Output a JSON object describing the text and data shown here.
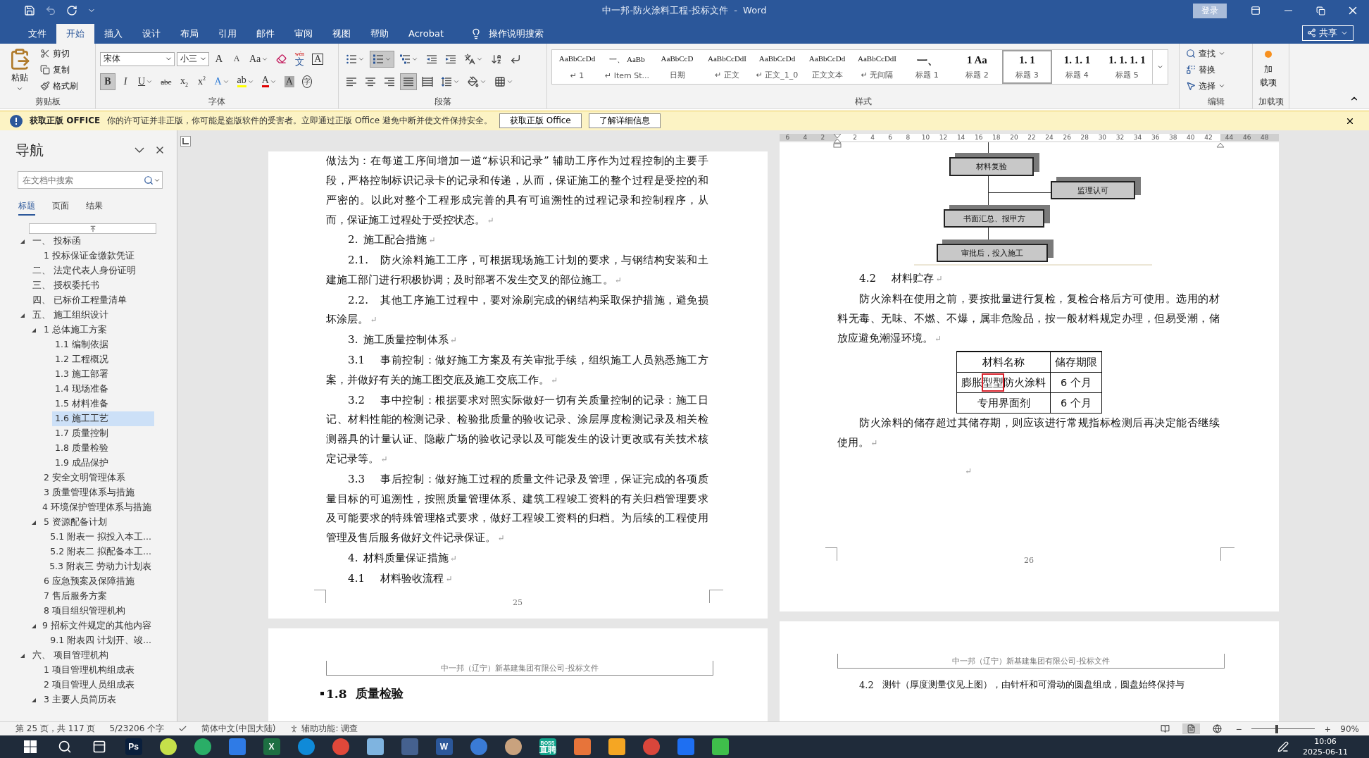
{
  "title_bar": {
    "title": "中一邦-防火涂料工程-投标文件  -  Word",
    "signin": "登录"
  },
  "ribbon_tabs": [
    {
      "label": "文件",
      "selected": false
    },
    {
      "label": "开始",
      "selected": true
    },
    {
      "label": "插入",
      "selected": false
    },
    {
      "label": "设计",
      "selected": false
    },
    {
      "label": "布局",
      "selected": false
    },
    {
      "label": "引用",
      "selected": false
    },
    {
      "label": "邮件",
      "selected": false
    },
    {
      "label": "审阅",
      "selected": false
    },
    {
      "label": "视图",
      "selected": false
    },
    {
      "label": "帮助",
      "selected": false
    },
    {
      "label": "Acrobat",
      "selected": false
    }
  ],
  "tell_me": "操作说明搜索",
  "share": "共享",
  "ribbon": {
    "clipboard": {
      "label": "剪贴板",
      "paste": "粘贴",
      "actions": [
        {
          "kind": "cut",
          "label": "剪切"
        },
        {
          "kind": "copy",
          "label": "复制"
        },
        {
          "kind": "painter",
          "label": "格式刷"
        }
      ]
    },
    "font": {
      "label": "字体",
      "font_name": "宋体",
      "font_size": "小三",
      "row1": [
        {
          "kind": "grow",
          "text": "A"
        },
        {
          "kind": "shrink",
          "text": "A"
        },
        {
          "kind": "case",
          "text": "Aa",
          "dropdown": true
        },
        {
          "kind": "clear"
        },
        {
          "kind": "phonetic",
          "text": "文",
          "ruby": "wén"
        },
        {
          "kind": "border",
          "text": "A"
        }
      ],
      "row2": [
        {
          "kind": "bold",
          "text": "B",
          "pressed": true
        },
        {
          "kind": "italic",
          "text": "I",
          "pressed": false
        },
        {
          "kind": "underline",
          "text": "U",
          "pressed": false,
          "dropdown": true
        },
        {
          "kind": "strike",
          "text": "abc"
        },
        {
          "kind": "sub",
          "text": "x",
          "script": "2"
        },
        {
          "kind": "sup",
          "text": "x",
          "script": "2"
        },
        {
          "kind": "effects",
          "text": "A",
          "dropdown": true
        },
        {
          "kind": "highlight",
          "text": "ab",
          "color": "#ffff00",
          "dropdown": true
        },
        {
          "kind": "color",
          "text": "A",
          "color": "#e00000",
          "dropdown": true
        },
        {
          "kind": "shading",
          "text": "A"
        },
        {
          "kind": "enclose",
          "text": "字"
        }
      ]
    },
    "paragraph": {
      "label": "段落",
      "row1": [
        {
          "kind": "bullets",
          "pressed": false,
          "dropdown": true
        },
        {
          "kind": "numbering",
          "pressed": true,
          "dropdown": true
        },
        {
          "kind": "multilevel",
          "pressed": false,
          "dropdown": true
        },
        {
          "kind": "outdent",
          "pressed": false
        },
        {
          "kind": "indent",
          "pressed": false
        },
        {
          "kind": "asian",
          "pressed": false,
          "dropdown": true
        },
        {
          "kind": "sort",
          "pressed": false
        },
        {
          "kind": "marks",
          "pressed": false
        }
      ],
      "row2": [
        {
          "kind": "left",
          "pressed": false
        },
        {
          "kind": "center",
          "pressed": false
        },
        {
          "kind": "right",
          "pressed": false
        },
        {
          "kind": "justify",
          "pressed": true
        },
        {
          "kind": "distributed",
          "pressed": false
        },
        {
          "kind": "spacing",
          "pressed": false,
          "dropdown": true
        },
        {
          "kind": "shading",
          "pressed": false,
          "dropdown": true
        },
        {
          "kind": "borders",
          "pressed": false,
          "dropdown": true
        }
      ]
    },
    "styles": {
      "label": "样式",
      "items": [
        {
          "kind": "normal",
          "preview": "AaBbCcDd",
          "name": "↵ 1",
          "selected": false
        },
        {
          "kind": "normal",
          "preview": "一、 AaBb",
          "name": "↵ Item St...",
          "selected": false
        },
        {
          "kind": "normal",
          "preview": "AaBbCcD",
          "name": "日期",
          "selected": false
        },
        {
          "kind": "normal",
          "preview": "AaBbCcDdI",
          "name": "↵ 正文",
          "selected": false
        },
        {
          "kind": "normal",
          "preview": "AaBbCcDd",
          "name": "↵ 正文_1_0",
          "selected": false
        },
        {
          "kind": "normal",
          "preview": "AaBbCcDd",
          "name": "正文文本",
          "selected": false
        },
        {
          "kind": "normal",
          "preview": "AaBbCcDdI",
          "name": "↵ 无间隔",
          "selected": false
        },
        {
          "kind": "heading",
          "preview": "一、",
          "name": "标题 1",
          "selected": false
        },
        {
          "kind": "heading",
          "preview": "1   Aa",
          "name": "标题 2",
          "selected": false
        },
        {
          "kind": "heading",
          "preview": "1. 1",
          "name": "标题 3",
          "selected": true
        },
        {
          "kind": "heading",
          "preview": "1. 1. 1",
          "name": "标题 4",
          "selected": false
        },
        {
          "kind": "heading",
          "preview": "1. 1. 1. 1",
          "name": "标题 5",
          "selected": false
        }
      ]
    },
    "editing": {
      "label": "编辑",
      "actions": [
        {
          "kind": "find",
          "label": "查找",
          "dropdown": true
        },
        {
          "kind": "replace",
          "label": "替换",
          "dropdown": false
        },
        {
          "kind": "select",
          "label": "选择",
          "dropdown": true
        }
      ]
    },
    "addins": {
      "label": "加载项",
      "button_lines": [
        "加",
        "载项"
      ]
    }
  },
  "message_bar": {
    "title": "获取正版 OFFICE",
    "text": "你的许可证并非正版，你可能是盗版软件的受害者。立即通过正版 Office 避免中断并使文件保持安全。",
    "buttons": [
      "获取正版 Office",
      "了解详细信息"
    ]
  },
  "navigation": {
    "title": "导航",
    "search_placeholder": "在文档中搜索",
    "tabs": [
      {
        "label": "标题",
        "selected": true
      },
      {
        "label": "页面",
        "selected": false
      },
      {
        "label": "结果",
        "selected": false
      }
    ],
    "tree": [
      {
        "label": "一、 投标函",
        "expanded": true,
        "selected": false,
        "children": [
          {
            "label": "1 投标保证金缴款凭证",
            "selected": false
          }
        ]
      },
      {
        "label": "二、 法定代表人身份证明",
        "selected": false
      },
      {
        "label": "三、 授权委托书",
        "selected": false
      },
      {
        "label": "四、 已标价工程量清单",
        "selected": false
      },
      {
        "label": "五、 施工组织设计",
        "expanded": true,
        "selected": false,
        "children": [
          {
            "label": "1 总体施工方案",
            "expanded": true,
            "selected": false,
            "children": [
              {
                "label": "1.1 编制依据",
                "selected": false
              },
              {
                "label": "1.2 工程概况",
                "selected": false
              },
              {
                "label": "1.3 施工部署",
                "selected": false
              },
              {
                "label": "1.4 现场准备",
                "selected": false
              },
              {
                "label": "1.5 材料准备",
                "selected": false
              },
              {
                "label": "1.6 施工工艺",
                "selected": true
              },
              {
                "label": "1.7 质量控制",
                "selected": false
              },
              {
                "label": "1.8 质量检验",
                "selected": false
              },
              {
                "label": "1.9 成品保护",
                "selected": false
              }
            ]
          },
          {
            "label": "2 安全文明管理体系",
            "selected": false
          },
          {
            "label": "3 质量管理体系与措施",
            "selected": false
          },
          {
            "label": "4 环境保护管理体系与措施",
            "selected": false
          },
          {
            "label": "5 资源配备计划",
            "expanded": true,
            "selected": false,
            "children": [
              {
                "label": "5.1 附表一  拟投入本工...",
                "selected": false
              },
              {
                "label": "5.2 附表二  拟配备本工...",
                "selected": false
              },
              {
                "label": "5.3 附表三  劳动力计划表",
                "selected": false
              }
            ]
          },
          {
            "label": "6 应急预案及保障措施",
            "selected": false
          },
          {
            "label": "7 售后服务方案",
            "selected": false
          },
          {
            "label": "8 项目组织管理机构",
            "selected": false
          },
          {
            "label": "9 招标文件规定的其他内容",
            "expanded": true,
            "selected": false,
            "children": [
              {
                "label": "9.1 附表四  计划开、竣...",
                "selected": false
              }
            ]
          }
        ]
      },
      {
        "label": "六、 项目管理机构",
        "expanded": true,
        "selected": false,
        "children": [
          {
            "label": "1 项目管理机构组成表",
            "selected": false
          },
          {
            "label": "2 项目管理人员组成表",
            "selected": false
          },
          {
            "label": "3 主要人员简历表",
            "expanded": true,
            "selected": false
          }
        ]
      }
    ]
  },
  "ruler": {
    "left_margin_ticks": [
      "6",
      "4",
      "2"
    ],
    "text_ticks": [
      "2",
      "4",
      "6",
      "8",
      "10",
      "12",
      "14",
      "16",
      "18",
      "20",
      "22",
      "24",
      "26",
      "28",
      "30",
      "32",
      "34",
      "36",
      "38",
      "40",
      "42"
    ],
    "right_margin_ticks": [
      "44",
      "46",
      "48"
    ]
  },
  "page_25": {
    "number": "25",
    "paragraphs": [
      {
        "kind": "body",
        "text": "做法为：在每道工序间增加一道“标识和记录” 辅助工序作为过程控制的主要手段，严格控制标识记录卡的记录和传递，从而，保证施工的整个过程是受控的和严密的。以此对整个工程形成完善的具有可追溯性的过程记录和控制程序，从而，保证施工过程处于受控状态。",
        "mark": "↵"
      },
      {
        "kind": "heading",
        "number": "2.",
        "text": "施工配合措施",
        "mark": "↵"
      },
      {
        "kind": "item",
        "number": "2.1.",
        "text": "防火涂料施工工序，可根据现场施工计划的要求，与钢结构安装和土建施工部门进行积极协调；及时部署不发生交叉的部位施工。",
        "mark": "↵"
      },
      {
        "kind": "item",
        "number": "2.2.",
        "text": "其他工序施工过程中，要对涂刷完成的钢结构采取保护措施，避免损坏涂层。",
        "mark": "↵"
      },
      {
        "kind": "heading",
        "number": "3.",
        "text": "施工质量控制体系",
        "mark": "↵"
      },
      {
        "kind": "item",
        "number": "3.1",
        "text": "事前控制：做好施工方案及有关审批手续，组织施工人员熟悉施工方案，并做好有关的施工图交底及施工交底工作。",
        "mark": "↵"
      },
      {
        "kind": "item",
        "number": "3.2",
        "text": "事中控制：根据要求对照实际做好一切有关质量控制的记录：施工日记、材料性能的检测记录、检验批质量的验收记录、涂层厚度检测记录及相关检测器具的计量认证、隐蔽广场的验收记录以及可能发生的设计更改或有关技术核定记录等。",
        "mark": "↵"
      },
      {
        "kind": "item",
        "number": "3.3",
        "text": "事后控制：做好施工过程的质量文件记录及管理，保证完成的各项质量目标的可追溯性，按照质量管理体系、建筑工程竣工资料的有关归档管理要求及可能要求的特殊管理格式要求，做好工程竣工资料的归档。为后续的工程使用管理及售后服务做好文件记录保证。",
        "mark": "↵"
      },
      {
        "kind": "heading",
        "number": "4.",
        "text": "材料质量保证措施",
        "mark": "↵"
      },
      {
        "kind": "item",
        "number": "4.1",
        "text": "材料验收流程",
        "mark": "↵"
      }
    ]
  },
  "page_26": {
    "number": "26",
    "flowchart": {
      "nodes": [
        "材料复验",
        "监理认可",
        "书面汇总、报甲方",
        "审批后，投入施工"
      ]
    },
    "paragraphs_before": [
      {
        "kind": "item",
        "number": "4.2",
        "text": "材料贮存",
        "mark": "↵"
      },
      {
        "kind": "body_indent",
        "text": "防火涂料在使用之前，要按批量进行复检，复检合格后方可使用。选用的材料无毒、无味、不燃、不爆，属非危险品，按一般材料规定办理，但易受潮，储放应避免潮湿环境。",
        "mark": "↵"
      }
    ],
    "table": {
      "columns": [
        "材料名称",
        "储存期限"
      ],
      "rows": [
        [
          {
            "text": "膨胀型型防火涂料",
            "marked": true
          },
          {
            "text": "6 个月",
            "marked": false
          }
        ],
        [
          {
            "text": "专用界面剂",
            "marked": false
          },
          {
            "text": "6 个月",
            "marked": false
          }
        ]
      ]
    },
    "paragraphs_after": [
      {
        "kind": "body_indent",
        "text": "防火涂料的储存超过其储存期，则应该进行常规指标检测后再决定能否继续使用。",
        "mark": "↵"
      },
      {
        "kind": "empty",
        "mark": "↵"
      }
    ]
  },
  "next_pages": [
    {
      "header": "中一邦（辽宁）新基建集团有限公司-投标文件",
      "number": "1.8",
      "text": "质量检验",
      "kind": "heading"
    },
    {
      "header": "中一邦（辽宁）新基建集团有限公司-投标文件",
      "number": "4.2",
      "text": "测针（厚度测量仪见上图），由针杆和可滑动的圆盘组成，圆盘始终保持与",
      "kind": "item"
    }
  ],
  "status_bar": {
    "page": "第 25 页，共 117 页",
    "words": "5/23206 个字",
    "language": "简体中文(中国大陆)",
    "accessibility": "辅助功能: 调查",
    "views": [
      {
        "kind": "read",
        "selected": false
      },
      {
        "kind": "print",
        "selected": true
      },
      {
        "kind": "web",
        "selected": false
      }
    ],
    "zoom_out": "−",
    "zoom_in": "+",
    "zoom_slider": {
      "level": 0.4
    },
    "zoom": "90%"
  },
  "taskbar": {
    "apps": [
      {
        "kind": "start"
      },
      {
        "kind": "search"
      },
      {
        "kind": "taskview"
      },
      {
        "kind": "tile",
        "color": "#0a1f3c",
        "label": [
          "Ps"
        ]
      },
      {
        "kind": "circle",
        "color": "#c5e04a"
      },
      {
        "kind": "circle",
        "color": "#2aae67"
      },
      {
        "kind": "tile",
        "color": "#2f7be6"
      },
      {
        "kind": "tile",
        "color": "#1d6f42",
        "label": [
          "X"
        ]
      },
      {
        "kind": "circle",
        "color": "#0f8ad8"
      },
      {
        "kind": "circle",
        "color": "#e0483a"
      },
      {
        "kind": "tile",
        "color": "#7fb4e0"
      },
      {
        "kind": "tile",
        "color": "#45618f"
      },
      {
        "kind": "tile",
        "color": "#2b579a",
        "label": [
          "W"
        ]
      },
      {
        "kind": "circle",
        "color": "#3a7bd5"
      },
      {
        "kind": "avatar",
        "color": "#c9a27e"
      },
      {
        "kind": "tile",
        "color": "#12a58c",
        "label": [
          "BOSS",
          "直聘"
        ]
      },
      {
        "kind": "tile",
        "color": "#e7743a"
      },
      {
        "kind": "tile",
        "color": "#f5a623"
      },
      {
        "kind": "circle",
        "color": "#d9463b"
      },
      {
        "kind": "tile",
        "color": "#1e6ff2"
      },
      {
        "kind": "tile",
        "color": "#3fbf4b"
      }
    ],
    "time": "10:06",
    "date": "2025-06-11"
  }
}
